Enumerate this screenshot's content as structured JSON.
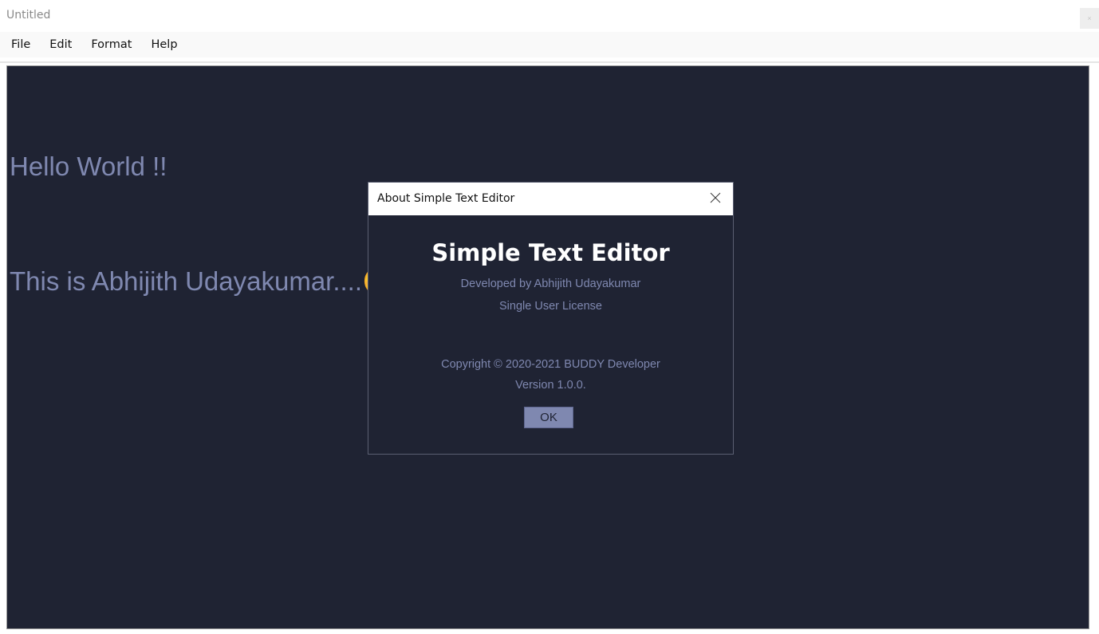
{
  "window": {
    "title": "Untitled",
    "close_glyph": "×"
  },
  "menu": {
    "items": [
      {
        "label": "File"
      },
      {
        "label": "Edit"
      },
      {
        "label": "Format"
      },
      {
        "label": "Help"
      }
    ]
  },
  "editor": {
    "line1": "Hello World !!",
    "line2": "This is Abhijith Udayakumar....😊"
  },
  "about_dialog": {
    "title": "About Simple Text Editor",
    "app_name": "Simple Text Editor",
    "developer": "Developed by Abhijith Udayakumar",
    "license": "Single User License",
    "copyright": "Copyright © 2020-2021 BUDDY Developer",
    "version": "Version 1.0.0.",
    "ok_label": "OK"
  },
  "colors": {
    "editor_background": "#1f2333",
    "editor_text": "#7f88b0",
    "dialog_heading": "#ffffff",
    "button_fill": "#7f88b0"
  },
  "icons": {
    "dialog_close": "close-icon"
  }
}
